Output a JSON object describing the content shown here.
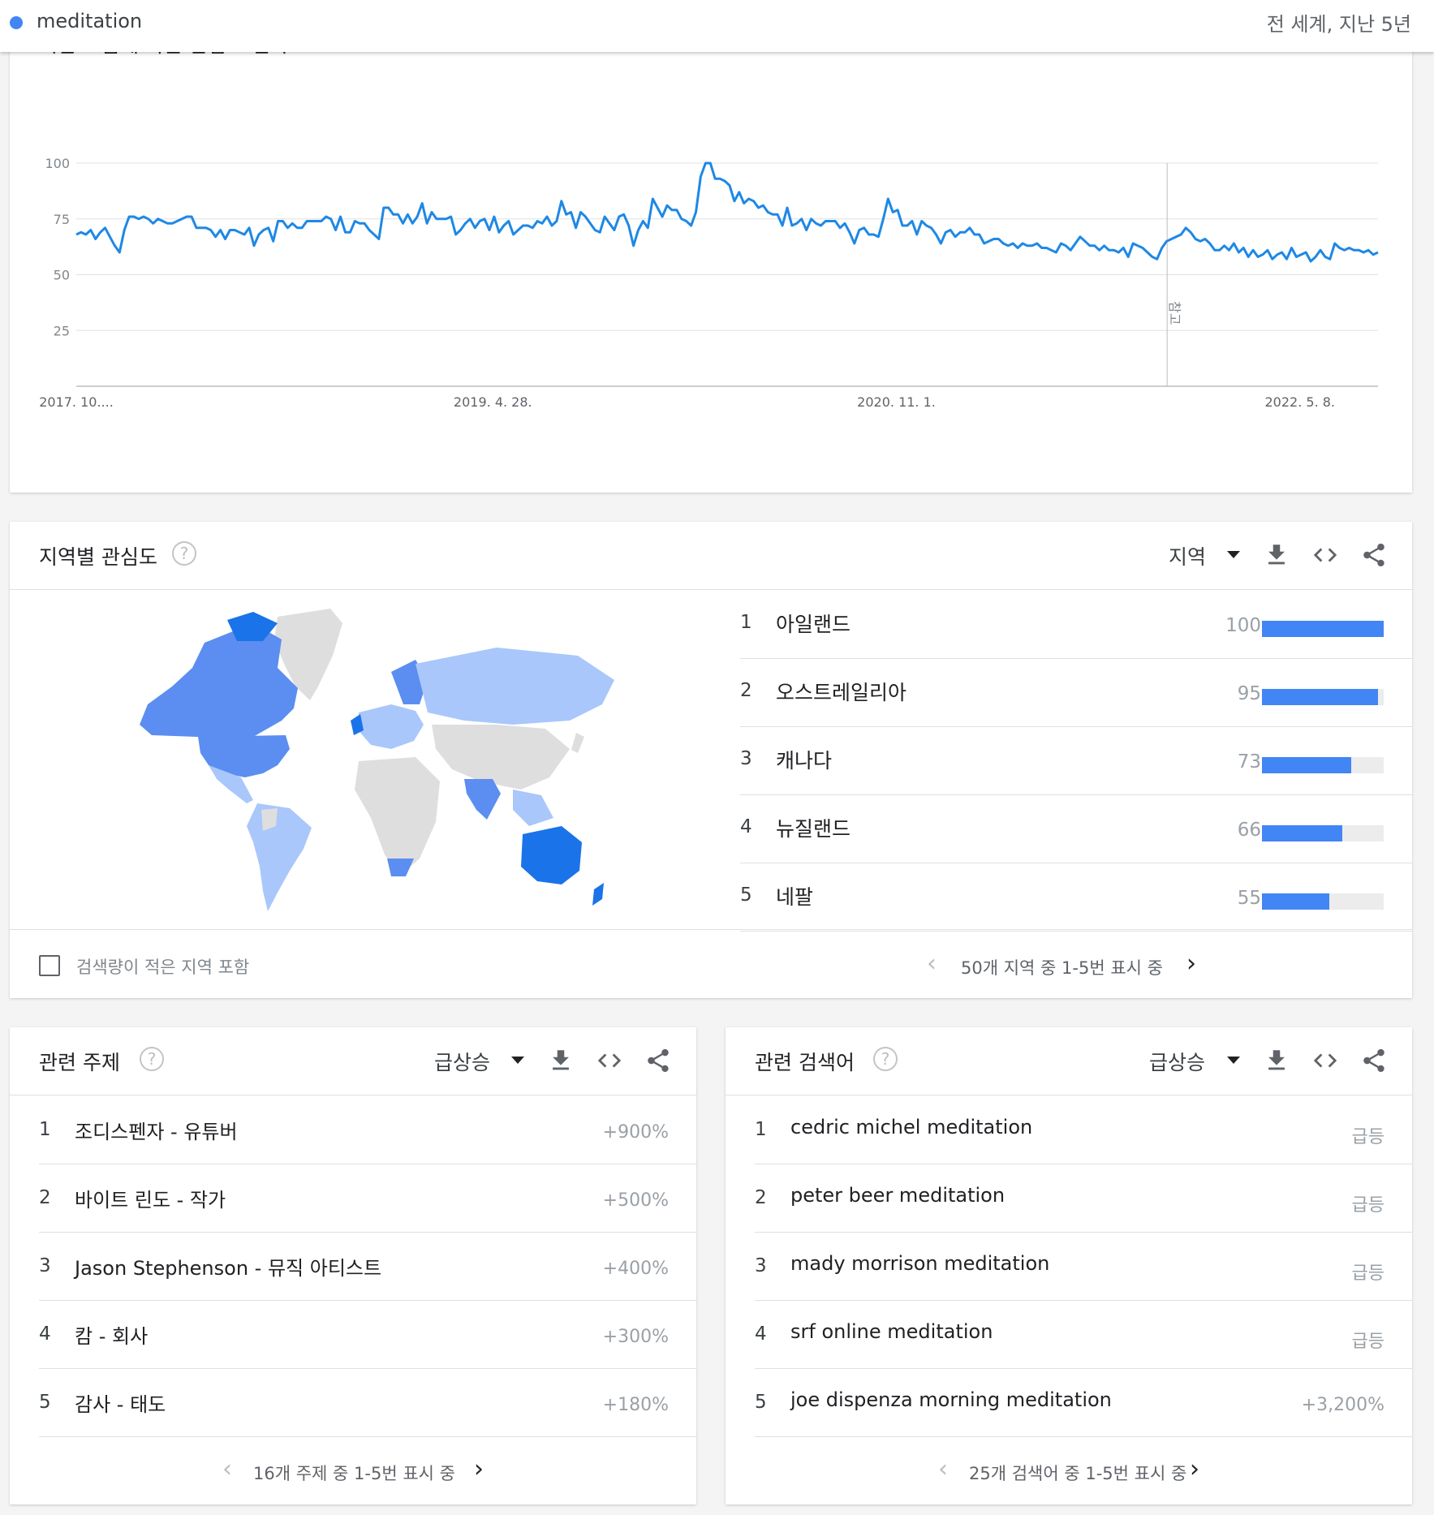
{
  "header": {
    "search_term": "meditation",
    "term_color": "#4285f4",
    "scope": "전 세계, 지난 5년"
  },
  "trend": {
    "title_partial": "시간 흐름에 따른 관심도 변화",
    "note_label": "참고",
    "icons": [
      "download-icon",
      "embed-icon",
      "share-icon"
    ],
    "chart_data": {
      "type": "line",
      "title": "",
      "xlabel": "",
      "ylabel": "",
      "ylim": [
        0,
        100
      ],
      "yticks": [
        25,
        50,
        75,
        100
      ],
      "xtick_labels": [
        "2017. 10....",
        "2019. 4. 28.",
        "2020. 11. 1.",
        "2022. 5. 8."
      ],
      "series_color": "#1e88e5",
      "grid": true,
      "note_position_fraction": 0.838,
      "series": [
        {
          "values": [
            68,
            69,
            68,
            70,
            66,
            69,
            71,
            67,
            63,
            60,
            70,
            76,
            76,
            75,
            76,
            75,
            73,
            75,
            74,
            73,
            73,
            74,
            75,
            76,
            76,
            71,
            71,
            71,
            70,
            67,
            70,
            66,
            70,
            70,
            69,
            68,
            71,
            63,
            68,
            70,
            71,
            65,
            74,
            74,
            71,
            73,
            71,
            71,
            74,
            74,
            74,
            74,
            76,
            75,
            70,
            76,
            69,
            69,
            74,
            73,
            73,
            70,
            68,
            66,
            80,
            80,
            77,
            77,
            73,
            77,
            73,
            76,
            82,
            73,
            78,
            75,
            75,
            75,
            76,
            68,
            70,
            73,
            75,
            71,
            74,
            75,
            70,
            76,
            69,
            72,
            74,
            68,
            70,
            72,
            72,
            71,
            74,
            73,
            76,
            72,
            74,
            83,
            77,
            78,
            71,
            78,
            76,
            73,
            70,
            69,
            76,
            73,
            70,
            76,
            77,
            72,
            63,
            70,
            74,
            71,
            84,
            80,
            76,
            81,
            79,
            79,
            75,
            74,
            72,
            78,
            94,
            100,
            100,
            93,
            93,
            92,
            90,
            83,
            87,
            82,
            84,
            83,
            80,
            81,
            78,
            77,
            77,
            72,
            80,
            72,
            73,
            75,
            70,
            75,
            73,
            72,
            74,
            74,
            74,
            71,
            73,
            69,
            64,
            70,
            71,
            68,
            68,
            67,
            75,
            84,
            78,
            79,
            72,
            72,
            74,
            68,
            74,
            72,
            71,
            68,
            64,
            69,
            70,
            67,
            69,
            69,
            71,
            68,
            68,
            64,
            65,
            66,
            66,
            64,
            63,
            64,
            62,
            64,
            63,
            63,
            64,
            62,
            62,
            61,
            60,
            64,
            63,
            61,
            64,
            67,
            65,
            63,
            63,
            61,
            63,
            61,
            61,
            60,
            62,
            58,
            64,
            63,
            62,
            60,
            58,
            57,
            62,
            65,
            66,
            67,
            68,
            71,
            69,
            66,
            65,
            66,
            64,
            61,
            61,
            63,
            61,
            64,
            60,
            62,
            58,
            61,
            58,
            59,
            61,
            57,
            59,
            60,
            57,
            62,
            58,
            59,
            60,
            56,
            58,
            61,
            58,
            57,
            64,
            62,
            61,
            62,
            61,
            61,
            60,
            61,
            59,
            60
          ]
        }
      ]
    }
  },
  "region": {
    "title": "지역별 관심도",
    "dropdown_label": "지역",
    "items": [
      {
        "rank": "1",
        "name": "아일랜드",
        "value": "100",
        "level": 100
      },
      {
        "rank": "2",
        "name": "오스트레일리아",
        "value": "95",
        "level": 95
      },
      {
        "rank": "3",
        "name": "캐나다",
        "value": "73",
        "level": 73
      },
      {
        "rank": "4",
        "name": "뉴질랜드",
        "value": "66",
        "level": 66
      },
      {
        "rank": "5",
        "name": "네팔",
        "value": "55",
        "level": 55
      }
    ],
    "checkbox_label": "검색량이 적은 지역 포함",
    "pagination": "50개 지역 중 1-5번 표시 중",
    "bar_color": "#4285f4",
    "map_colors": {
      "strong": "#1a73e8",
      "medium": "#5b8ef0",
      "light": "#a9c7fa",
      "none": "#dedede"
    }
  },
  "topics": {
    "title": "관련 주제",
    "dropdown_label": "급상승",
    "items": [
      {
        "rank": "1",
        "name": "조디스펜자 - 유튜버",
        "value": "+900%"
      },
      {
        "rank": "2",
        "name": "바이트 린도 - 작가",
        "value": "+500%"
      },
      {
        "rank": "3",
        "name": "Jason Stephenson - 뮤직 아티스트",
        "value": "+400%"
      },
      {
        "rank": "4",
        "name": "캄 - 회사",
        "value": "+300%"
      },
      {
        "rank": "5",
        "name": "감사 - 태도",
        "value": "+180%"
      }
    ],
    "pagination": "16개 주제 중 1-5번 표시 중"
  },
  "queries": {
    "title": "관련 검색어",
    "dropdown_label": "급상승",
    "items": [
      {
        "rank": "1",
        "name": "cedric michel meditation",
        "value": "급등"
      },
      {
        "rank": "2",
        "name": "peter beer meditation",
        "value": "급등"
      },
      {
        "rank": "3",
        "name": "mady morrison meditation",
        "value": "급등"
      },
      {
        "rank": "4",
        "name": "srf online meditation",
        "value": "급등"
      },
      {
        "rank": "5",
        "name": "joe dispenza morning meditation",
        "value": "+3,200%"
      }
    ],
    "pagination": "25개 검색어 중 1-5번 표시 중"
  }
}
